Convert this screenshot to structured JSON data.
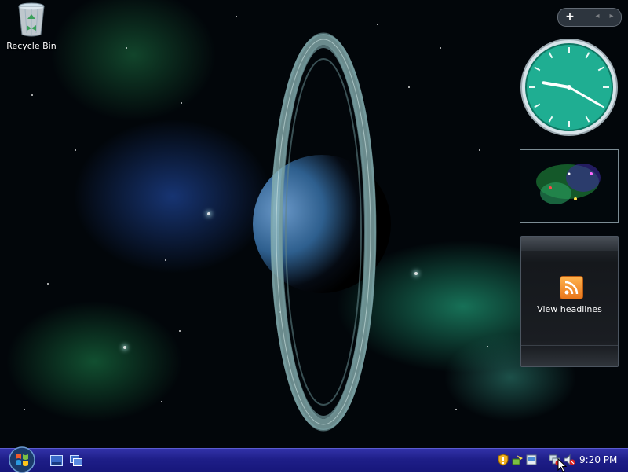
{
  "desktop": {
    "icons": [
      {
        "label": "Recycle Bin",
        "icon": "recycle-bin-icon"
      }
    ]
  },
  "sidebar": {
    "controls": {
      "add": "+",
      "prev": "◂",
      "next": "▸"
    },
    "clock": {
      "hour": 9,
      "minute": 20
    },
    "feed": {
      "label": "View headlines",
      "icon": "rss-feed-icon"
    }
  },
  "taskbar": {
    "start": "windows-start-orb-icon",
    "quick_launch": [
      "show-desktop-icon",
      "switch-windows-icon"
    ],
    "tray": [
      "security-shield-icon",
      "network-status-icon",
      "windows-update-icon",
      "network-disconnected-icon",
      "volume-muted-icon"
    ],
    "time": "9:20 PM"
  },
  "colors": {
    "taskbar": "#1e1e88",
    "clock_face": "#1fae92",
    "feed_icon": "#f08a2a"
  }
}
